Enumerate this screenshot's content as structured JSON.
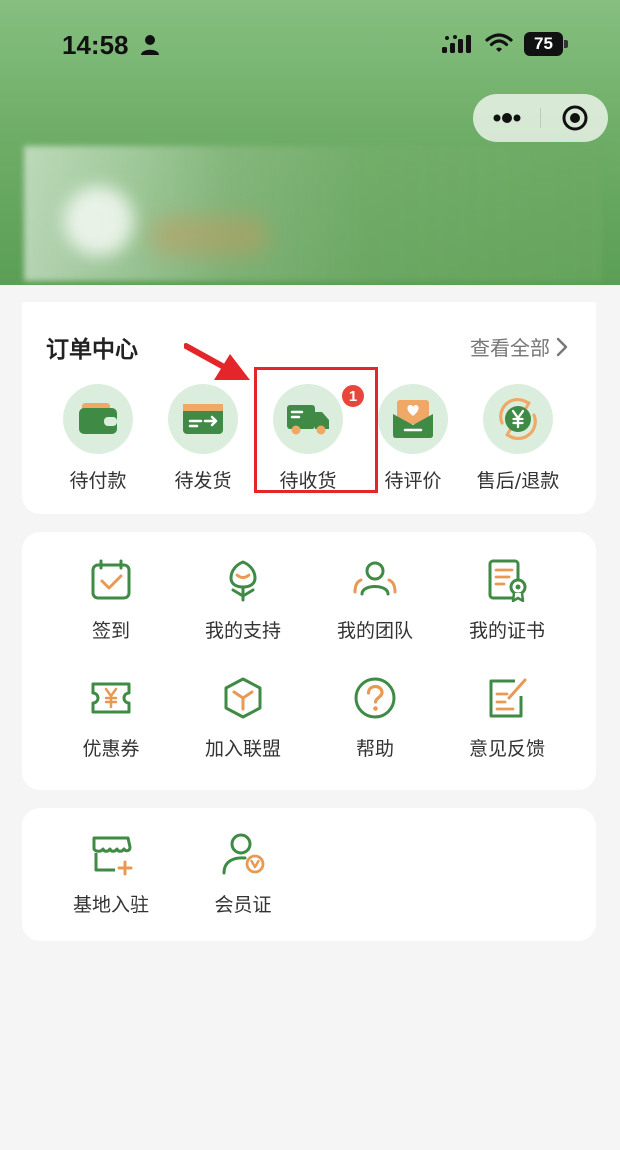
{
  "status_bar": {
    "time": "14:58",
    "battery": "75"
  },
  "orders": {
    "title": "订单中心",
    "view_all": "查看全部",
    "items": [
      {
        "label": "待付款",
        "icon": "wallet-icon"
      },
      {
        "label": "待发货",
        "icon": "card-arrow-icon"
      },
      {
        "label": "待收货",
        "icon": "truck-icon",
        "badge": "1"
      },
      {
        "label": "待评价",
        "icon": "heart-envelope-icon"
      },
      {
        "label": "售后/退款",
        "icon": "yen-refresh-icon"
      }
    ]
  },
  "services": {
    "items": [
      {
        "label": "签到",
        "icon": "calendar-check-icon"
      },
      {
        "label": "我的支持",
        "icon": "tulip-icon"
      },
      {
        "label": "我的团队",
        "icon": "team-icon"
      },
      {
        "label": "我的证书",
        "icon": "certificate-icon"
      },
      {
        "label": "优惠券",
        "icon": "coupon-icon"
      },
      {
        "label": "加入联盟",
        "icon": "cube-icon"
      },
      {
        "label": "帮助",
        "icon": "help-icon"
      },
      {
        "label": "意见反馈",
        "icon": "feedback-edit-icon"
      }
    ]
  },
  "tools": {
    "items": [
      {
        "label": "基地入驻",
        "icon": "shop-add-icon"
      },
      {
        "label": "会员证",
        "icon": "member-icon"
      }
    ]
  },
  "colors": {
    "primary_green": "#3f8a45",
    "accent_orange": "#e89a55",
    "badge_red": "#e8463b",
    "highlight_red": "#e4262a"
  }
}
